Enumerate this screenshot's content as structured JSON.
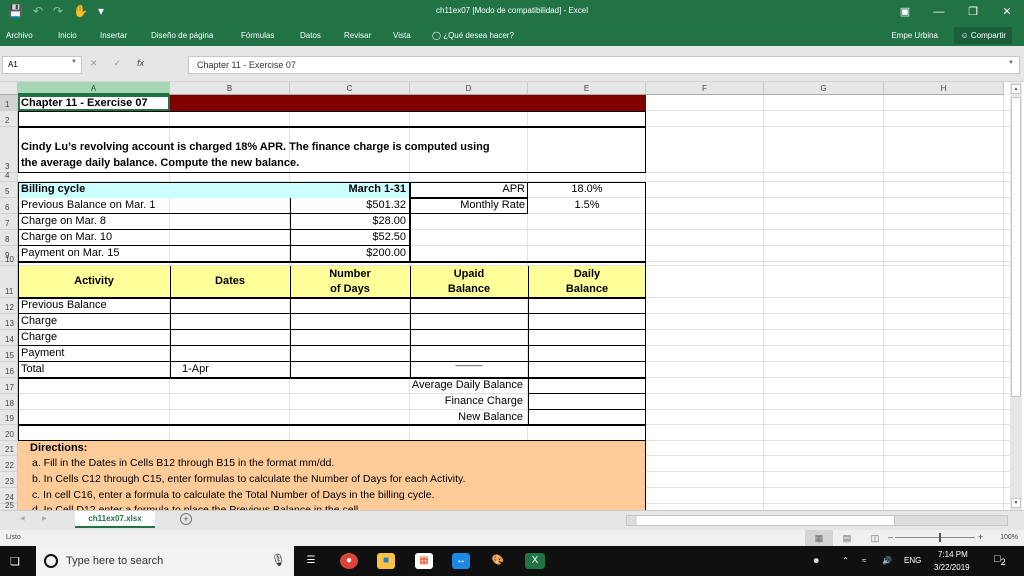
{
  "window": {
    "title": "ch11ex07  [Modo de compatibilidad] - Excel"
  },
  "qat": {
    "icons": [
      "save-icon",
      "undo-icon",
      "redo-icon",
      "touch-mode-icon",
      "customize-icon"
    ]
  },
  "ribbon": {
    "tabs": [
      "Archivo",
      "Inicio",
      "Insertar",
      "Diseño de página",
      "Fórmulas",
      "Datos",
      "Revisar",
      "Vista"
    ],
    "tell_me": "¿Qué desea hacer?",
    "user": "Empe Urbina",
    "share": "Compartir"
  },
  "formula_bar": {
    "name_box": "A1",
    "formula": "Chapter 11 - Exercise 07",
    "fx": "fx"
  },
  "columns": [
    "A",
    "B",
    "C",
    "D",
    "E",
    "F",
    "G",
    "H"
  ],
  "rows": [
    "1",
    "2",
    "3",
    "4",
    "5",
    "6",
    "7",
    "8",
    "9",
    "10",
    "11",
    "12",
    "13",
    "14",
    "15",
    "16",
    "17",
    "18",
    "19",
    "20",
    "21",
    "22",
    "23",
    "24",
    "25"
  ],
  "sheet": {
    "title": "Chapter 11 - Exercise 07",
    "problem_line1": "Cindy Lu’s revolving account is charged 18% APR. The finance charge is computed using",
    "problem_line2": "the average daily balance. Compute the new balance.",
    "billing": {
      "label": "Billing cycle",
      "period": "March 1-31",
      "items": [
        {
          "label": "Previous Balance on Mar. 1",
          "amount": "$501.32"
        },
        {
          "label": "Charge on Mar. 8",
          "amount": "$28.00"
        },
        {
          "label": "Charge on Mar. 10",
          "amount": "$52.50"
        },
        {
          "label": "Payment on Mar. 15",
          "amount": "$200.00"
        }
      ]
    },
    "rates": {
      "apr_label": "APR",
      "apr": "18.0%",
      "monthly_label": "Monthly Rate",
      "monthly": "1.5%"
    },
    "table": {
      "headers": {
        "activity": "Activity",
        "dates": "Dates",
        "days1": "Number",
        "days2": "of Days",
        "unpaid1": "Upaid",
        "unpaid2": "Balance",
        "daily1": "Daily",
        "daily2": "Balance"
      },
      "rows": [
        "Previous Balance",
        "Charge",
        "Charge",
        "Payment",
        "Total"
      ],
      "total_date": "1-Apr",
      "total_unpaid": "———"
    },
    "summary": [
      "Average Daily Balance",
      "Finance Charge",
      "New Balance"
    ],
    "directions": {
      "title": "Directions:",
      "items": [
        "a.  Fill in the Dates in Cells B12 through B15 in the format mm/dd.",
        "b.  In Cells C12 through C15, enter formulas to calculate the Number of Days for each Activity.",
        "c.  In cell C16, enter a formula to calculate the Total Number of Days in the billing cycle.",
        "d.  In Cell D12 enter a formula to place the Previous Balance in the cell"
      ]
    }
  },
  "sheet_tab": "ch11ex07.xlsx",
  "status": {
    "ready": "Listo",
    "zoom": "100%"
  },
  "taskbar": {
    "search_placeholder": "Type here to search",
    "lang": "ENG",
    "time": "7:14 PM",
    "date": "3/22/2019",
    "notifications": "2"
  },
  "colors": {
    "excel_green": "#217346",
    "title_fill": "#800000",
    "billing_fill": "#ccffff",
    "header_fill": "#ffff99",
    "directions_fill": "#ffcc99"
  }
}
